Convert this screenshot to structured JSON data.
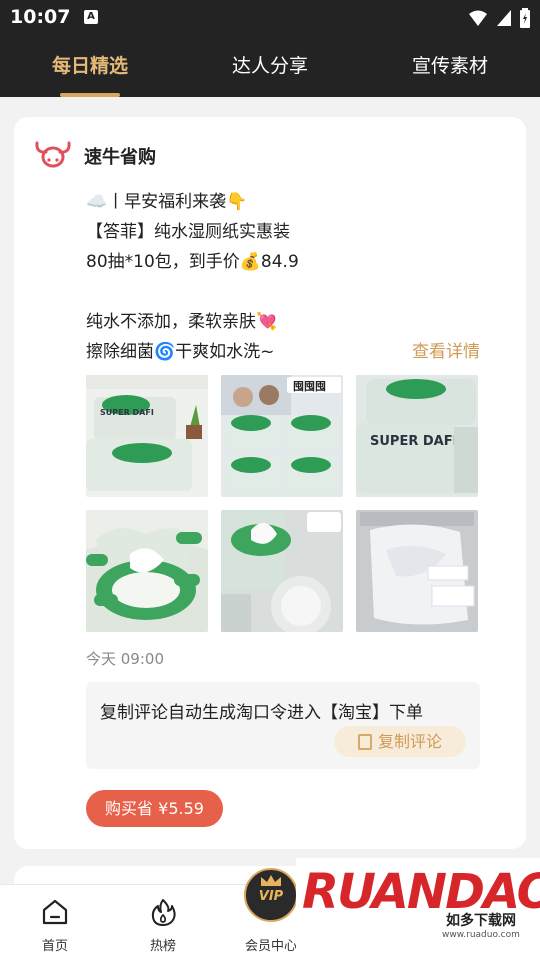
{
  "status_bar": {
    "time": "10:07",
    "notif_icon": "A"
  },
  "tabs": [
    {
      "label": "每日精选",
      "active": true
    },
    {
      "label": "达人分享",
      "active": false
    },
    {
      "label": "宣传素材",
      "active": false
    }
  ],
  "post": {
    "brand": "速牛省购",
    "lines": [
      "☁️丨早安福利来袭👇",
      "【答菲】纯水湿厕纸实惠装",
      "80抽*10包，到手价💰84.9",
      "纯水不添加，柔软亲肤💘",
      "擦除细菌🌀干爽如水洗~"
    ],
    "detail_link": "查看详情",
    "image_captions": [
      "SUPER DAFI",
      "囤囤囤",
      "SUPER DAFI"
    ],
    "time": "今天 09:00",
    "comment_text": "复制评论自动生成淘口令进入【淘宝】下单",
    "copy_button": "复制评论",
    "buy_button": "购买省 ¥5.59"
  },
  "bottom_nav": [
    {
      "label": "首页",
      "icon": "home-icon"
    },
    {
      "label": "热榜",
      "icon": "flame-icon"
    },
    {
      "label": "会员中心",
      "icon": "vip-crown-icon"
    }
  ],
  "vip_badge": "VIP",
  "watermark": {
    "logo": "RUANDAO",
    "tag": "如多下载网",
    "url": "www.ruaduo.com"
  },
  "colors": {
    "accent": "#d9a65f",
    "buy": "#e7604a",
    "dark": "#232323"
  }
}
